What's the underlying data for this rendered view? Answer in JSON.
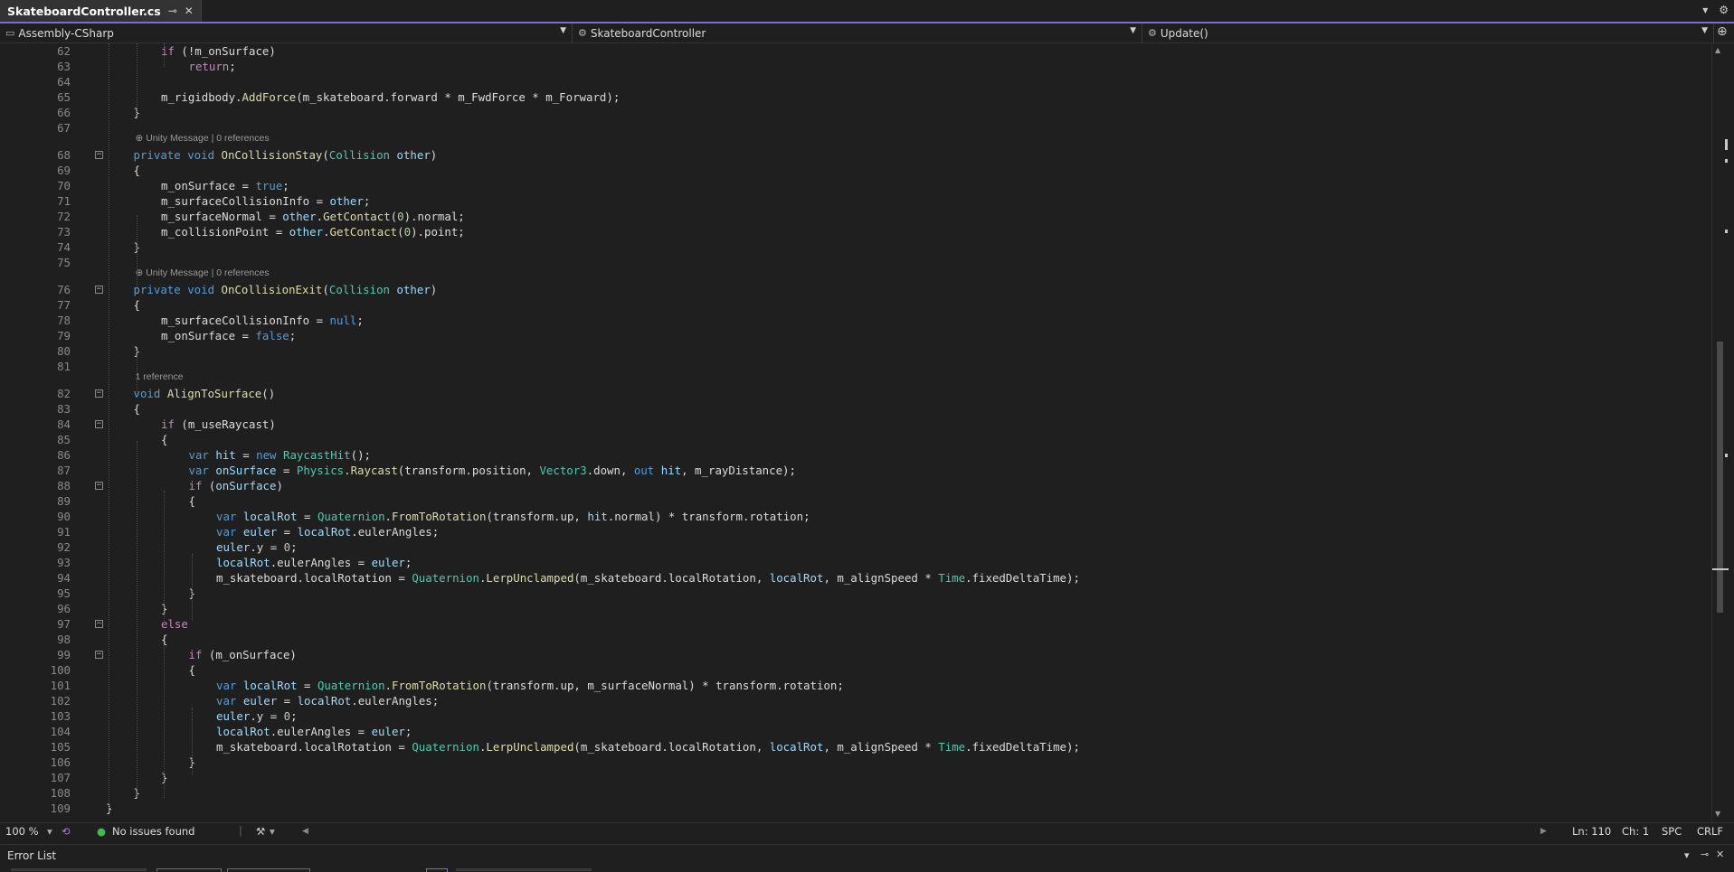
{
  "tab": {
    "title": "SkateboardController.cs",
    "pin_glyph": "⊸",
    "close_glyph": "✕"
  },
  "tabbar_right": {
    "dropdown_glyph": "▾",
    "settings_glyph": "⚙"
  },
  "navbar": {
    "project": "Assembly-CSharp",
    "class": "SkateboardController",
    "member": "Update()",
    "split_glyph": "⊕"
  },
  "codelens": [
    {
      "before_line": 68,
      "text": "⊕ Unity Message | 0 references"
    },
    {
      "before_line": 76,
      "text": "⊕ Unity Message | 0 references"
    },
    {
      "before_line": 82,
      "text": "1 reference"
    }
  ],
  "code_lines": [
    {
      "n": "62",
      "html": "<span class=\"c\">if</span> (!m_onSurface)",
      "indent": 2,
      "fold": false
    },
    {
      "n": "63",
      "html": "<span class=\"c\">return</span>;",
      "indent": 3,
      "fold": false
    },
    {
      "n": "64",
      "html": "",
      "indent": 0,
      "fold": false
    },
    {
      "n": "65",
      "html": "m_rigidbody.<span class=\"m\">AddForce</span>(m_skateboard.forward * m_FwdForce * m_Forward);",
      "indent": 2,
      "fold": false
    },
    {
      "n": "66",
      "html": "}",
      "indent": 1,
      "fold": false
    },
    {
      "n": "67",
      "html": "",
      "indent": 0,
      "fold": false
    },
    {
      "n": "68",
      "html": "<span class=\"k\">private</span> <span class=\"k\">void</span> <span class=\"m\">OnCollisionStay</span>(<span class=\"t\">Collision</span> <span class=\"v\">other</span>)",
      "indent": 1,
      "fold": true
    },
    {
      "n": "69",
      "html": "{",
      "indent": 1,
      "fold": false
    },
    {
      "n": "70",
      "html": "m_onSurface = <span class=\"k\">true</span>;",
      "indent": 2,
      "fold": false
    },
    {
      "n": "71",
      "html": "m_surfaceCollisionInfo = <span class=\"v\">other</span>;",
      "indent": 2,
      "fold": false
    },
    {
      "n": "72",
      "html": "m_surfaceNormal = <span class=\"v\">other</span>.<span class=\"m\">GetContact</span>(<span class=\"n\">0</span>).normal;",
      "indent": 2,
      "fold": false
    },
    {
      "n": "73",
      "html": "m_collisionPoint = <span class=\"v\">other</span>.<span class=\"m\">GetContact</span>(<span class=\"n\">0</span>).point;",
      "indent": 2,
      "fold": false
    },
    {
      "n": "74",
      "html": "}",
      "indent": 1,
      "fold": false
    },
    {
      "n": "75",
      "html": "",
      "indent": 0,
      "fold": false
    },
    {
      "n": "76",
      "html": "<span class=\"k\">private</span> <span class=\"k\">void</span> <span class=\"m\">OnCollisionExit</span>(<span class=\"t\">Collision</span> <span class=\"v\">other</span>)",
      "indent": 1,
      "fold": true
    },
    {
      "n": "77",
      "html": "{",
      "indent": 1,
      "fold": false
    },
    {
      "n": "78",
      "html": "m_surfaceCollisionInfo = <span class=\"k\">null</span>;",
      "indent": 2,
      "fold": false
    },
    {
      "n": "79",
      "html": "m_onSurface = <span class=\"k\">false</span>;",
      "indent": 2,
      "fold": false
    },
    {
      "n": "80",
      "html": "}",
      "indent": 1,
      "fold": false
    },
    {
      "n": "81",
      "html": "",
      "indent": 0,
      "fold": false
    },
    {
      "n": "82",
      "html": "<span class=\"k\">void</span> <span class=\"m\">AlignToSurface</span>()",
      "indent": 1,
      "fold": true
    },
    {
      "n": "83",
      "html": "{",
      "indent": 1,
      "fold": false
    },
    {
      "n": "84",
      "html": "<span class=\"c\">if</span> (m_useRaycast)",
      "indent": 2,
      "fold": true
    },
    {
      "n": "85",
      "html": "{",
      "indent": 2,
      "fold": false
    },
    {
      "n": "86",
      "html": "<span class=\"k\">var</span> <span class=\"v\">hit</span> = <span class=\"k\">new</span> <span class=\"t\">RaycastHit</span>();",
      "indent": 3,
      "fold": false
    },
    {
      "n": "87",
      "html": "<span class=\"k\">var</span> <span class=\"v\">onSurface</span> = <span class=\"t\">Physics</span>.<span class=\"m\">Raycast</span>(transform.position, <span class=\"t\">Vector3</span>.down, <span class=\"k\">out</span> <span class=\"v\">hit</span>, m_rayDistance);",
      "indent": 3,
      "fold": false
    },
    {
      "n": "88",
      "html": "<span class=\"c\">if</span> (<span class=\"v\">onSurface</span>)",
      "indent": 3,
      "fold": true
    },
    {
      "n": "89",
      "html": "{",
      "indent": 3,
      "fold": false
    },
    {
      "n": "90",
      "html": "<span class=\"k\">var</span> <span class=\"v\">localRot</span> = <span class=\"t\">Quaternion</span>.<span class=\"m\">FromToRotation</span>(transform.up, <span class=\"v\">hit</span>.normal) * transform.rotation;",
      "indent": 4,
      "fold": false
    },
    {
      "n": "91",
      "html": "<span class=\"k\">var</span> <span class=\"v\">euler</span> = <span class=\"v\">localRot</span>.eulerAngles;",
      "indent": 4,
      "fold": false
    },
    {
      "n": "92",
      "html": "<span class=\"v\">euler</span>.y = <span class=\"n\">0</span>;",
      "indent": 4,
      "fold": false
    },
    {
      "n": "93",
      "html": "<span class=\"v\">localRot</span>.eulerAngles = <span class=\"v\">euler</span>;",
      "indent": 4,
      "fold": false
    },
    {
      "n": "94",
      "html": "m_skateboard.localRotation = <span class=\"t\">Quaternion</span>.<span class=\"m\">LerpUnclamped</span>(m_skateboard.localRotation, <span class=\"v\">localRot</span>, m_alignSpeed * <span class=\"t\">Time</span>.fixedDeltaTime);",
      "indent": 4,
      "fold": false
    },
    {
      "n": "95",
      "html": "}",
      "indent": 3,
      "fold": false
    },
    {
      "n": "96",
      "html": "}",
      "indent": 2,
      "fold": false
    },
    {
      "n": "97",
      "html": "<span class=\"c\">else</span>",
      "indent": 2,
      "fold": true
    },
    {
      "n": "98",
      "html": "{",
      "indent": 2,
      "fold": false
    },
    {
      "n": "99",
      "html": "<span class=\"c\">if</span> (m_onSurface)",
      "indent": 3,
      "fold": true
    },
    {
      "n": "100",
      "html": "{",
      "indent": 3,
      "fold": false
    },
    {
      "n": "101",
      "html": "<span class=\"k\">var</span> <span class=\"v\">localRot</span> = <span class=\"t\">Quaternion</span>.<span class=\"m\">FromToRotation</span>(transform.up, m_surfaceNormal) * transform.rotation;",
      "indent": 4,
      "fold": false
    },
    {
      "n": "102",
      "html": "<span class=\"k\">var</span> <span class=\"v\">euler</span> = <span class=\"v\">localRot</span>.eulerAngles;",
      "indent": 4,
      "fold": false
    },
    {
      "n": "103",
      "html": "<span class=\"v\">euler</span>.y = <span class=\"n\">0</span>;",
      "indent": 4,
      "fold": false
    },
    {
      "n": "104",
      "html": "<span class=\"v\">localRot</span>.eulerAngles = <span class=\"v\">euler</span>;",
      "indent": 4,
      "fold": false
    },
    {
      "n": "105",
      "html": "m_skateboard.localRotation = <span class=\"t\">Quaternion</span>.<span class=\"m\">LerpUnclamped</span>(m_skateboard.localRotation, <span class=\"v\">localRot</span>, m_alignSpeed * <span class=\"t\">Time</span>.fixedDeltaTime);",
      "indent": 4,
      "fold": false
    },
    {
      "n": "106",
      "html": "}",
      "indent": 3,
      "fold": false
    },
    {
      "n": "107",
      "html": "}",
      "indent": 2,
      "fold": false
    },
    {
      "n": "108",
      "html": "}",
      "indent": 1,
      "fold": false
    },
    {
      "n": "109",
      "html": "}",
      "indent": 0,
      "fold": false
    }
  ],
  "statusbar": {
    "zoom": "100 %",
    "issues": "No issues found",
    "line": "Ln: 110",
    "col": "Ch: 1",
    "whitespace": "SPC",
    "eol": "CRLF"
  },
  "error_list": {
    "title": "Error List"
  }
}
